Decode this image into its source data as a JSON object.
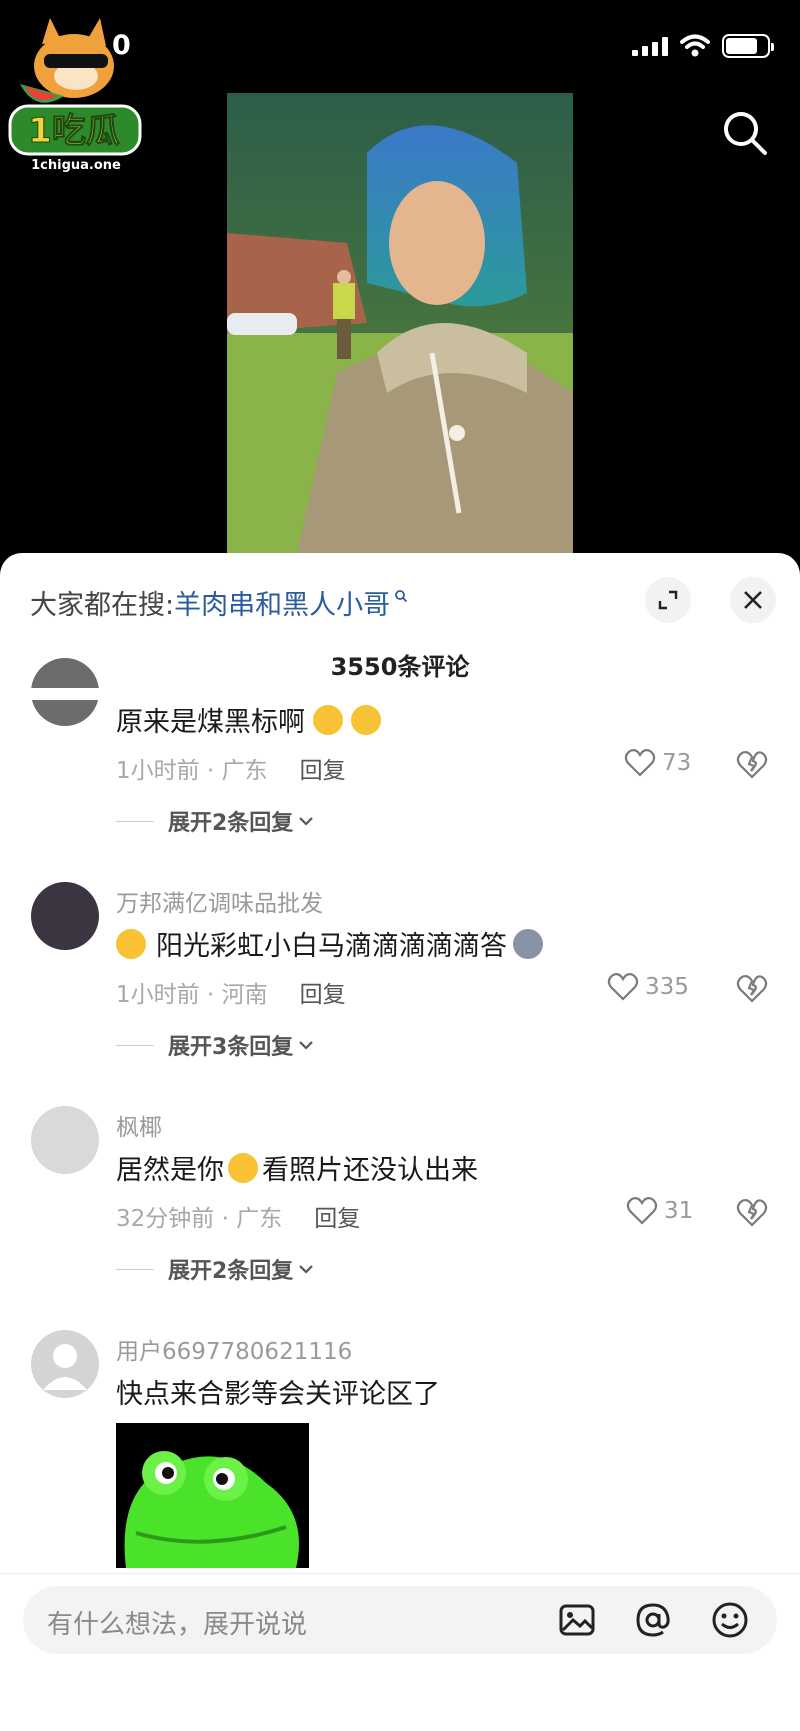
{
  "status_bar": {
    "time": "0"
  },
  "logo": {
    "brand": "1吃瓜",
    "domain": "1chigua.one"
  },
  "sheet": {
    "hot_search_prefix": "大家都在搜:",
    "hot_search_keyword": "羊肉串和黑人小哥",
    "comment_count": "3550条评论"
  },
  "comments": [
    {
      "user": "",
      "text": "原来是煤黑标啊",
      "time_loc": "1小时前 · 广东",
      "reply": "回复",
      "likes": "73",
      "expand": "展开2条回复"
    },
    {
      "user": "万邦满亿调味品批发",
      "text": "阳光彩虹小白马滴滴滴滴滴答",
      "time_loc": "1小时前 · 河南",
      "reply": "回复",
      "likes": "335",
      "expand": "展开3条回复"
    },
    {
      "user": "枫椰",
      "text_a": "居然是你",
      "text_b": "看照片还没认出来",
      "time_loc": "32分钟前 · 广东",
      "reply": "回复",
      "likes": "31",
      "expand": "展开2条回复"
    },
    {
      "user": "用户6697780621116",
      "text": "快点来合影等会关评论区了"
    }
  ],
  "input": {
    "placeholder": "有什么想法，展开说说"
  },
  "colors": {
    "accent_link": "#2b5c9e",
    "sticker_frog": "#4be22a"
  }
}
